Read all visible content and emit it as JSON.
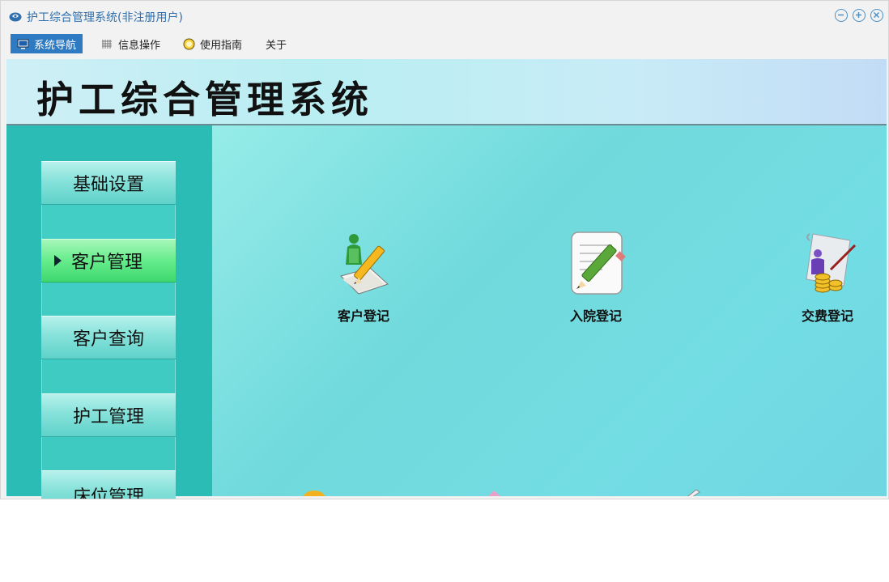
{
  "window": {
    "title": "护工综合管理系统(非注册用户)"
  },
  "menu": {
    "items": [
      {
        "label": "系统导航",
        "icon": "monitor-icon",
        "active": true
      },
      {
        "label": "信息操作",
        "icon": "grid-icon",
        "active": false
      },
      {
        "label": "使用指南",
        "icon": "help-icon",
        "active": false
      },
      {
        "label": "关于",
        "icon": "",
        "active": false
      }
    ]
  },
  "header": {
    "title": "护工综合管理系统"
  },
  "sidebar": {
    "items": [
      {
        "label": "基础设置",
        "active": false
      },
      {
        "label": "客户管理",
        "active": true
      },
      {
        "label": "客户查询",
        "active": false
      },
      {
        "label": "护工管理",
        "active": false
      },
      {
        "label": "床位管理",
        "active": false
      }
    ]
  },
  "content": {
    "tiles": [
      {
        "label": "客户登记",
        "icon": "customer-register-icon"
      },
      {
        "label": "入院登记",
        "icon": "admission-register-icon"
      },
      {
        "label": "交费登记",
        "icon": "payment-register-icon"
      }
    ]
  },
  "colors": {
    "accent": "#2e7bc4",
    "sidebar": "#2bbcb6",
    "active_item": "#4fe37f",
    "content_bg": "#7ddfe2"
  }
}
